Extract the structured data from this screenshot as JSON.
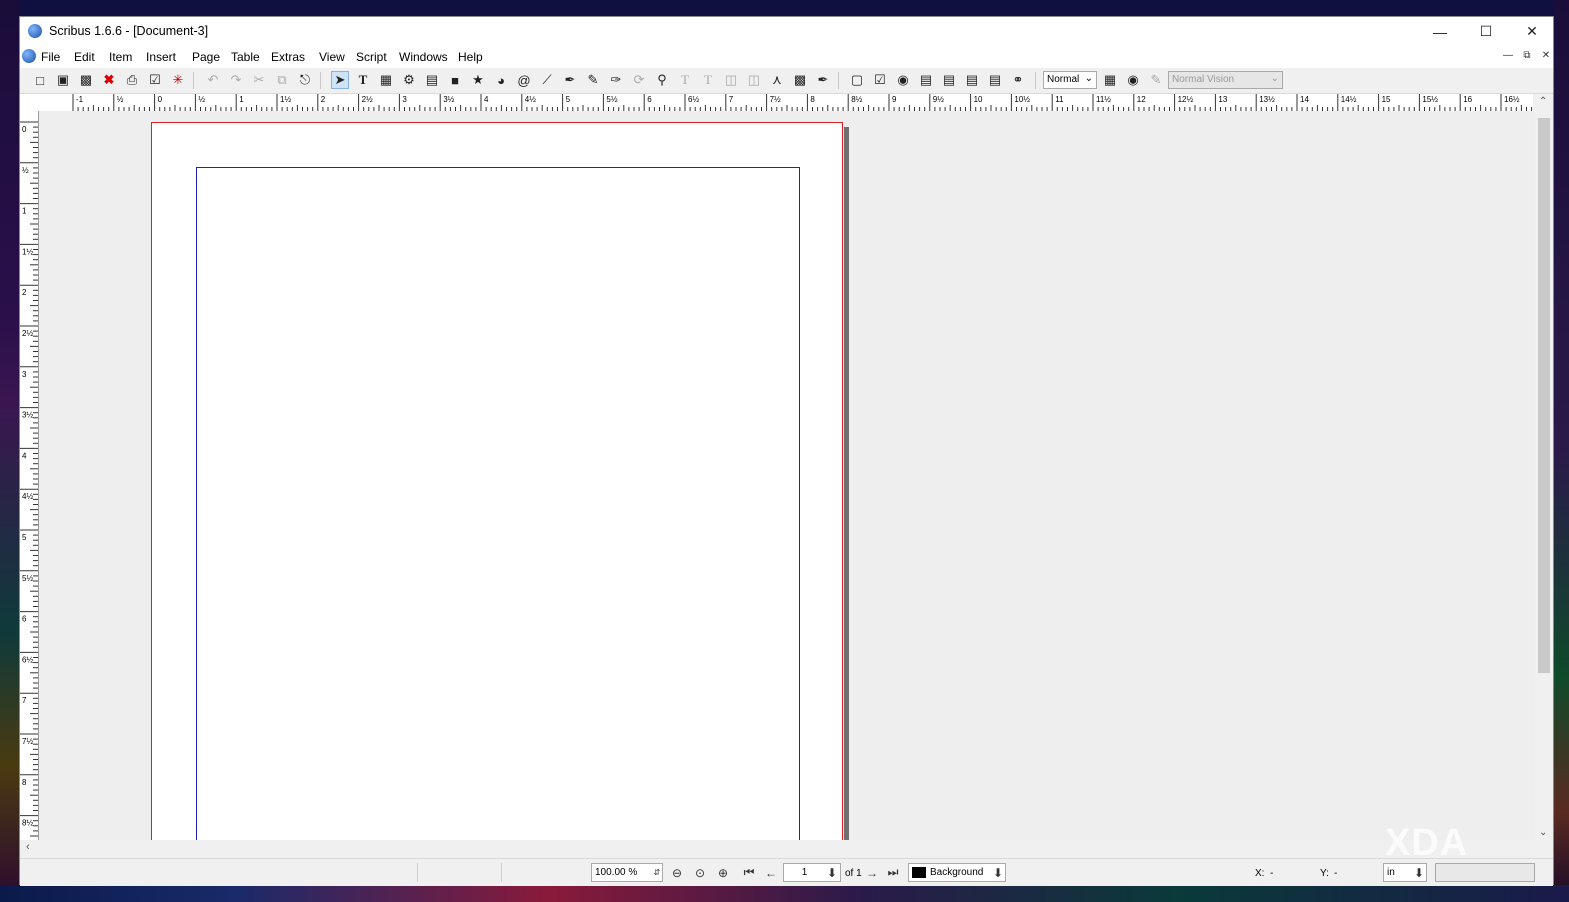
{
  "window": {
    "title": "Scribus 1.6.6 - [Document-3]"
  },
  "menu": [
    "File",
    "Edit",
    "Item",
    "Insert",
    "Page",
    "Table",
    "Extras",
    "View",
    "Script",
    "Windows",
    "Help"
  ],
  "toolbar": {
    "preview_mode": "Normal",
    "vision_mode": "Normal Vision"
  },
  "ruler_h": {
    "labels": [
      "-1",
      "½",
      "0",
      "½",
      "1",
      "1½",
      "2",
      "2½",
      "3",
      "3½",
      "4",
      "4½",
      "5",
      "5½",
      "6",
      "6½",
      "7",
      "7½",
      "8",
      "8½",
      "9",
      "9½",
      "10",
      "10½",
      "11",
      "11½",
      "12",
      "12½",
      "13",
      "13½",
      "14",
      "14½",
      "15",
      "15½",
      "16",
      "16½"
    ]
  },
  "ruler_v": {
    "labels": [
      "0",
      "½",
      "1",
      "1½",
      "2",
      "2½",
      "3",
      "3½",
      "4",
      "4½",
      "5",
      "5½",
      "6",
      "6½",
      "7",
      "7½",
      "8",
      "8½"
    ]
  },
  "status": {
    "zoom": "100.00 %",
    "page_number": "1",
    "page_total": "of 1",
    "layer": "Background",
    "x_label": "X:",
    "x_value": "-",
    "y_label": "Y:",
    "y_value": "-",
    "unit": "in"
  },
  "watermark": "XDA",
  "colors": {
    "page_border": "#e02020",
    "margin_guide": "#2020c0",
    "canvas": "#eeeeee"
  }
}
